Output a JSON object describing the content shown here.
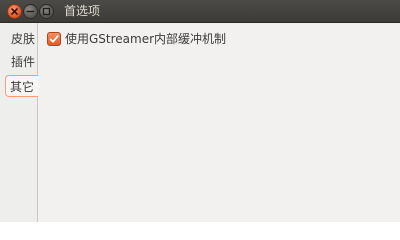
{
  "window": {
    "title": "首选项",
    "controls": {
      "close": "close-icon",
      "minimize": "minimize-icon",
      "maximize": "maximize-icon"
    }
  },
  "sidebar": {
    "tabs": [
      {
        "label": "皮肤",
        "active": false
      },
      {
        "label": "插件",
        "active": false
      },
      {
        "label": "其它",
        "active": true
      }
    ]
  },
  "main": {
    "options": [
      {
        "label": "使用GStreamer内部缓冲机制",
        "checked": true
      }
    ]
  },
  "colors": {
    "accent": "#dd5a27",
    "titlebar": "#3c3b37",
    "title_text": "#dfdbd2"
  }
}
